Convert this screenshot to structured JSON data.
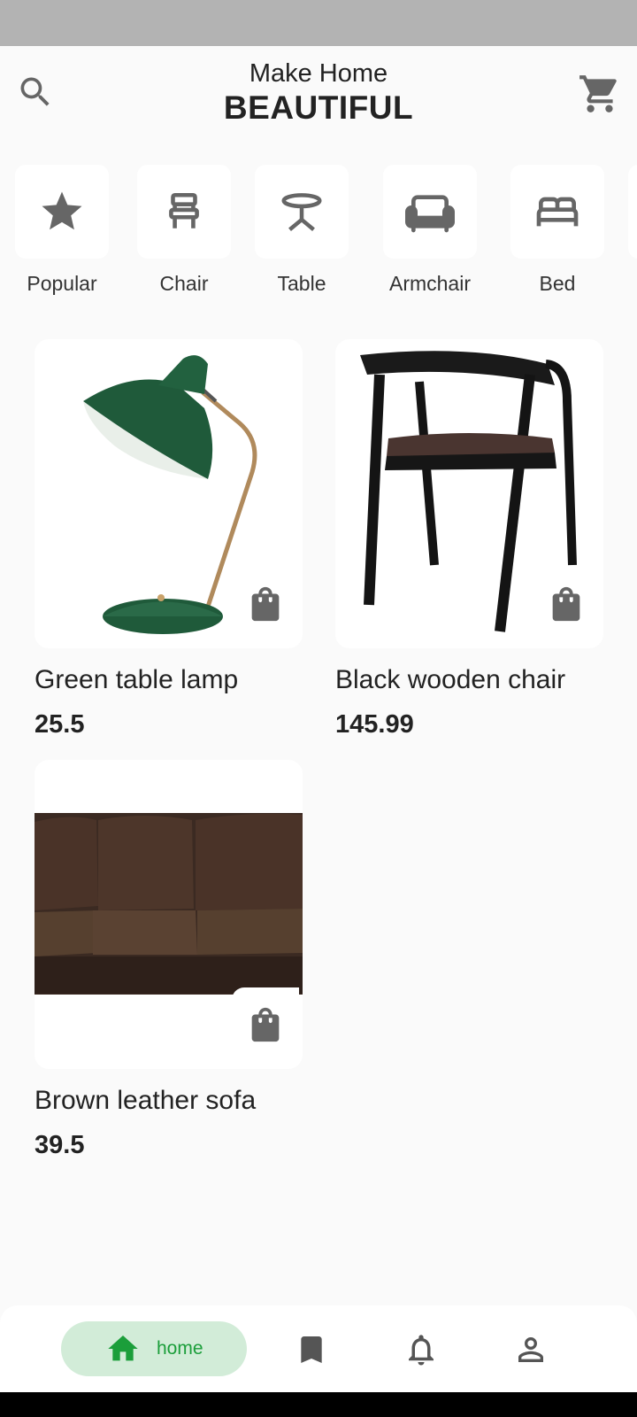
{
  "header": {
    "title_sub": "Make Home",
    "title_main": "BEAUTIFUL",
    "search_icon": "search-icon",
    "cart_icon": "cart-icon"
  },
  "categories": [
    {
      "label": "Popular",
      "icon": "star-icon"
    },
    {
      "label": "Chair",
      "icon": "chair-icon"
    },
    {
      "label": "Table",
      "icon": "table-icon"
    },
    {
      "label": "Armchair",
      "icon": "armchair-icon"
    },
    {
      "label": "Bed",
      "icon": "bed-icon"
    }
  ],
  "products": [
    {
      "name": "Green table lamp",
      "price": "25.5"
    },
    {
      "name": "Black wooden chair",
      "price": "145.99"
    },
    {
      "name": "Brown leather sofa",
      "price": "39.5"
    }
  ],
  "nav": {
    "home_label": "home",
    "active_color": "#1b9e3a",
    "active_bg": "#d2ecd8"
  },
  "colors": {
    "icon_gray": "#666666",
    "background": "#fafafa"
  }
}
